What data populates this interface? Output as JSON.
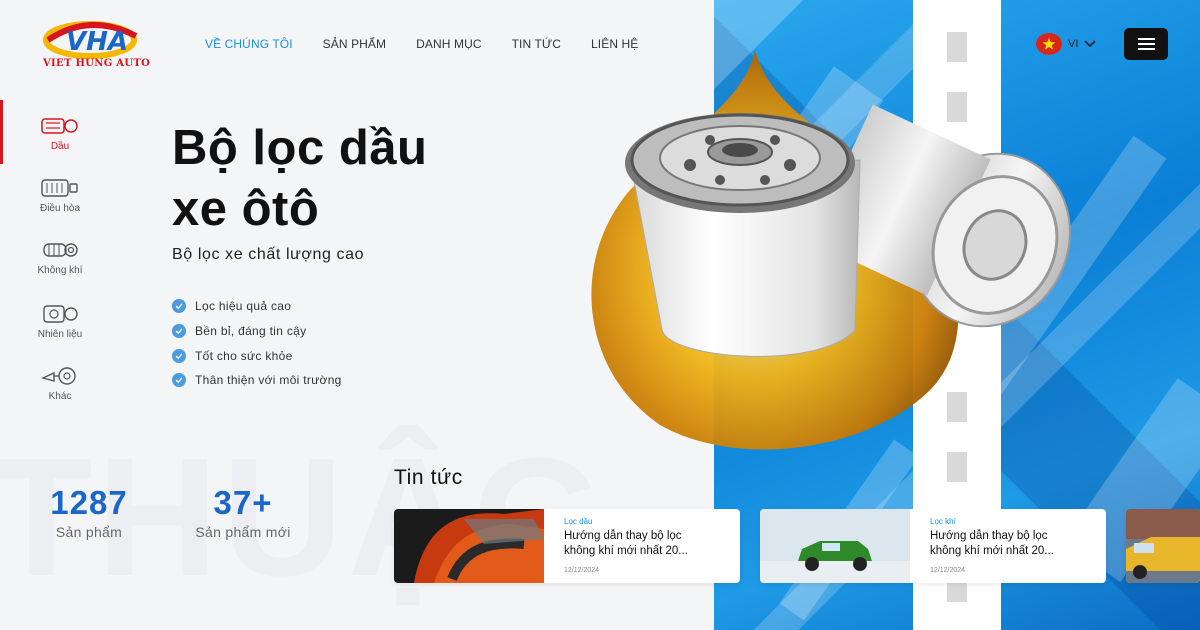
{
  "brand": {
    "name": "VIET HUNG AUTO",
    "logo_letters": "VHA"
  },
  "nav": {
    "items": [
      {
        "label": "VỀ CHÚNG TÔI",
        "active": true
      },
      {
        "label": "SẢN PHẨM",
        "active": false
      },
      {
        "label": "DANH MỤC",
        "active": false
      },
      {
        "label": "TIN TỨC",
        "active": false
      },
      {
        "label": "LIÊN HỆ",
        "active": false
      }
    ],
    "language": {
      "code": "VI",
      "flag_icon": "vietnam-flag-icon"
    },
    "menu_icon": "hamburger-menu-icon"
  },
  "categories": [
    {
      "label": "Dầu",
      "icon": "oil-pump-icon",
      "active": true
    },
    {
      "label": "Điều hòa",
      "icon": "air-conditioner-icon",
      "active": false
    },
    {
      "label": "Không khí",
      "icon": "air-filter-icon",
      "active": false
    },
    {
      "label": "Nhiên liệu",
      "icon": "fuel-pump-icon",
      "active": false
    },
    {
      "label": "Khác",
      "icon": "horn-icon",
      "active": false
    }
  ],
  "hero": {
    "title_line1": "Bộ lọc dầu",
    "title_line2": "xe ôtô",
    "subtitle": "Bộ lọc xe chất lượng cao",
    "features": [
      "Lọc hiệu quả cao",
      "Bền bỉ, đáng tin cậy",
      "Tốt cho sức khỏe",
      "Thân thiện với môi trường"
    ]
  },
  "watermark": "THUẬG",
  "stats": [
    {
      "value": "1287",
      "caption": "Sản phẩm"
    },
    {
      "value": "37+",
      "caption": "Sản phẩm mới"
    }
  ],
  "news": {
    "heading": "Tin tức",
    "cards": [
      {
        "tag": "Lọc dầu",
        "headline_line1": "Hướng dẫn thay bộ lọc",
        "headline_line2": "không khí mới nhất 20...",
        "date": "12/12/2024"
      },
      {
        "tag": "Lọc khí",
        "headline_line1": "Hướng dẫn thay bộ lọc",
        "headline_line2": "không khí mới nhất 20...",
        "date": "12/12/2024"
      }
    ]
  },
  "colors": {
    "accent_blue": "#1a8fe3",
    "brand_red": "#d8141c",
    "stat_blue": "#1a66c9",
    "panel_blue": "#0a7fd6",
    "menu_button": "#111111"
  }
}
